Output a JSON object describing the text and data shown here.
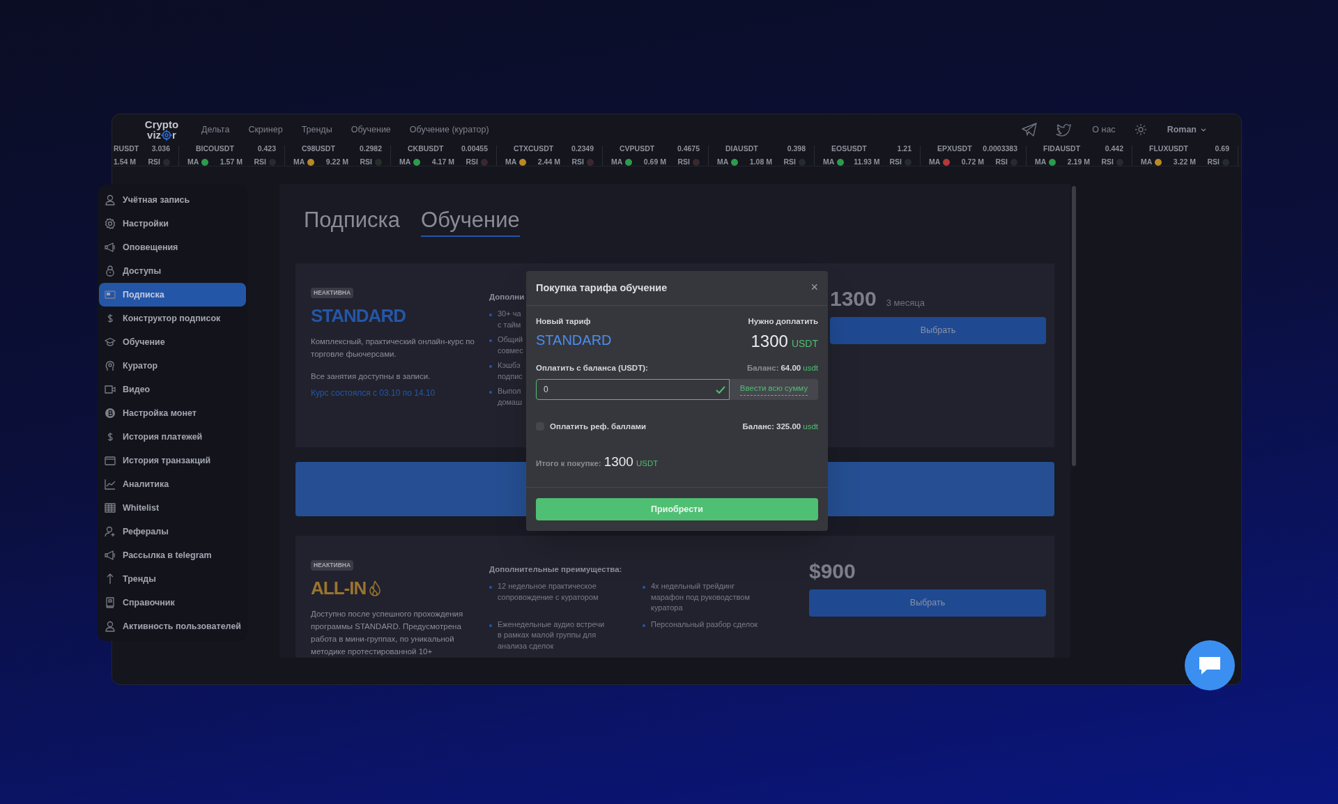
{
  "header": {
    "logo": {
      "line1": "Crypto",
      "line2_start": "viz",
      "line2_end": "r"
    },
    "nav": [
      "Дельта",
      "Скринер",
      "Тренды",
      "Обучение",
      "Обучение (куратор)"
    ],
    "about": "О нас",
    "user": "Roman"
  },
  "ticker": [
    {
      "symbol": "RUSDT",
      "price": "3.036",
      "volume": "1.54 M",
      "rsi": {
        "label": "RSI",
        "color": "#262a33"
      }
    },
    {
      "symbol": "BICOUSDT",
      "price": "0.423",
      "ma": {
        "label": "MA",
        "color": "#2e9a4c"
      },
      "volume": "1.57 M",
      "rsi": {
        "label": "RSI",
        "color": "#262a33"
      }
    },
    {
      "symbol": "C98USDT",
      "price": "0.2982",
      "ma": {
        "label": "MA",
        "color": "#b88a26"
      },
      "volume": "9.22 M",
      "rsi": {
        "label": "RSI",
        "color": "#23302a"
      }
    },
    {
      "symbol": "CKBUSDT",
      "price": "0.00455",
      "ma": {
        "label": "MA",
        "color": "#2e9a4c"
      },
      "volume": "4.17 M",
      "rsi": {
        "label": "RSI",
        "color": "#3a2830"
      }
    },
    {
      "symbol": "CTXCUSDT",
      "price": "0.2349",
      "ma": {
        "label": "MA",
        "color": "#b88a26"
      },
      "volume": "2.44 M",
      "rsi": {
        "label": "RSI",
        "color": "#3a2830"
      }
    },
    {
      "symbol": "CVPUSDT",
      "price": "0.4675",
      "ma": {
        "label": "MA",
        "color": "#2e9a4c"
      },
      "volume": "0.69 M",
      "rsi": {
        "label": "RSI",
        "color": "#3a2830"
      }
    },
    {
      "symbol": "DIAUSDT",
      "price": "0.398",
      "ma": {
        "label": "MA",
        "color": "#2e9a4c"
      },
      "volume": "1.08 M",
      "rsi": {
        "label": "RSI",
        "color": "#262a33"
      }
    },
    {
      "symbol": "EOSUSDT",
      "price": "1.21",
      "ma": {
        "label": "MA",
        "color": "#2e9a4c"
      },
      "volume": "11.93 M",
      "rsi": {
        "label": "RSI",
        "color": "#262a33"
      }
    },
    {
      "symbol": "EPXUSDT",
      "price": "0.0003383",
      "ma": {
        "label": "MA",
        "color": "#b23a3a"
      },
      "volume": "0.72 M",
      "rsi": {
        "label": "RSI",
        "color": "#262a33"
      }
    },
    {
      "symbol": "FIDAUSDT",
      "price": "0.442",
      "ma": {
        "label": "MA",
        "color": "#2e9a4c"
      },
      "volume": "2.19 M",
      "rsi": {
        "label": "RSI",
        "color": "#262a33"
      }
    },
    {
      "symbol": "FLUXUSDT",
      "price": "0.69",
      "ma": {
        "label": "MA",
        "color": "#b88a26"
      },
      "volume": "3.22 M",
      "rsi": {
        "label": "RSI",
        "color": "#262a33"
      }
    }
  ],
  "sidebar": {
    "items": [
      {
        "label": "Учётная запись",
        "selected": false
      },
      {
        "label": "Настройки",
        "selected": false
      },
      {
        "label": "Оповещения",
        "selected": false
      },
      {
        "label": "Доступы",
        "selected": false
      },
      {
        "label": "Подписка",
        "selected": true
      },
      {
        "label": "Конструктор подписок",
        "selected": false
      },
      {
        "label": "Обучение",
        "selected": false
      },
      {
        "label": "Куратор",
        "selected": false
      },
      {
        "label": "Видео",
        "selected": false
      },
      {
        "label": "Настройка монет",
        "selected": false
      },
      {
        "label": "История платежей",
        "selected": false
      },
      {
        "label": "История транзакций",
        "selected": false
      },
      {
        "label": "Аналитика",
        "selected": false
      },
      {
        "label": "Whitelist",
        "selected": false
      },
      {
        "label": "Рефералы",
        "selected": false
      },
      {
        "label": "Рассылка в telegram",
        "selected": false
      },
      {
        "label": "Тренды",
        "selected": false
      },
      {
        "label": "Справочник",
        "selected": false
      },
      {
        "label": "Активность пользователей",
        "selected": false
      }
    ]
  },
  "tabs": [
    {
      "label": "Подписка",
      "selected": false
    },
    {
      "label": "Обучение",
      "selected": true
    }
  ],
  "plans": [
    {
      "badge": "НЕАКТИВНА",
      "name": "STANDARD",
      "kind": "standard",
      "description": [
        "Комплексный, практический онлайн-курс по торговле фьючерсами.",
        "Все занятия доступны в записи."
      ],
      "note": "Курс состоялся с 03.10 по 14.10",
      "benefits_title": "Дополни",
      "benefits": [
        {
          "lines": [
            "30+ ча",
            "с тайм"
          ]
        },
        {
          "lines": [
            "Общий",
            "совмес"
          ]
        },
        {
          "lines": [
            "Кэшбэ",
            "подпис"
          ]
        },
        {
          "lines": [
            "Выпол",
            "домаш"
          ]
        }
      ],
      "price": "1300",
      "period": "3 месяца",
      "button": "Выбрать"
    },
    {
      "badge": "НЕАКТИВНА",
      "name": "ALL-IN",
      "kind": "premium",
      "description": [
        "Доступно после успешного прохождения программы STANDARD. Предусмотрена работа в мини-группах, по уникальной методике протестированной 10+"
      ],
      "benefits_title": "Дополнительные преимущества:",
      "benefits": [
        {
          "lines": [
            "12 недельное практическое",
            "сопровождение с куратором"
          ]
        },
        {
          "lines": [
            "4х недельный трейдинг",
            "марафон под руководством",
            "куратора"
          ]
        },
        {
          "lines": [
            "Еженедельные аудио встречи",
            "в рамках малой группы для",
            "анализа сделок"
          ]
        },
        {
          "lines": [
            "Персональный разбор сделок"
          ]
        }
      ],
      "price": "$900",
      "button": "Выбрать"
    }
  ],
  "modal": {
    "title": "Покупка тарифа обучение",
    "close": "×",
    "new_plan_label": "Новый тариф",
    "new_plan": "STANDARD",
    "due_label": "Нужно доплатить",
    "due_amount": "1300",
    "due_unit": "USDT",
    "balance_label": "Оплатить с баланса (USDT):",
    "balance": {
      "label": "Баланс:",
      "amount": "64.00",
      "unit": "usdt",
      "muted": true
    },
    "amount_input": {
      "value": "0",
      "valid": true
    },
    "fill_all": "Ввести всю сумму",
    "ref": {
      "label": "Оплатить реф. баллами",
      "checked": false
    },
    "ref_balance": {
      "label": "Баланс:",
      "amount": "325.00",
      "unit": "usdt",
      "muted": false
    },
    "total_label": "Итого к покупке:",
    "total_amount": "1300",
    "total_unit": "USDT",
    "submit": "Приобрести"
  }
}
